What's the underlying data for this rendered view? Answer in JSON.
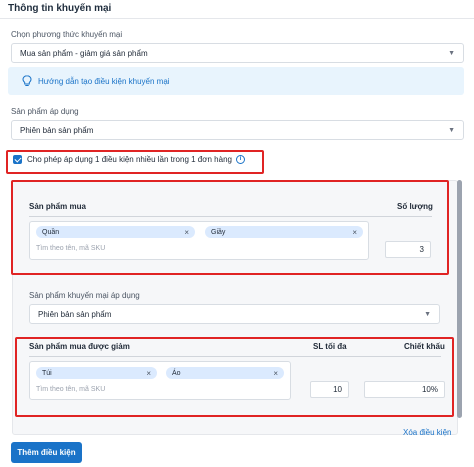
{
  "section": {
    "title": "Thông tin khuyến mại"
  },
  "promo_method": {
    "label": "Chọn phương thức khuyến mại",
    "value": "Mua sản phẩm - giảm giá sản phẩm"
  },
  "guide": {
    "link_text": "Hướng dẫn tạo điều kiện khuyến mại"
  },
  "applied_product": {
    "label": "Sản phẩm áp dụng",
    "value": "Phiên bản sản phẩm"
  },
  "allow_multiple": {
    "text": "Cho phép áp dụng 1 điều kiện nhiều lần trong 1 đơn hàng",
    "checked": true
  },
  "condition": {
    "buy": {
      "header_product": "Sản phẩm mua",
      "header_qty": "Số lượng",
      "tags": [
        "Quần",
        "Giầy"
      ],
      "search_hint": "Tìm theo tên, mã SKU",
      "quantity": "3"
    },
    "promo_applied": {
      "label": "Sản phẩm khuyến mại áp dụng",
      "value": "Phiên bản sản phẩm"
    },
    "discount": {
      "header_product": "Sản phẩm mua được giảm",
      "header_max_qty": "SL tối đa",
      "header_discount": "Chiết khấu",
      "tags": [
        "Túi",
        "Áo"
      ],
      "search_hint": "Tìm theo tên, mã SKU",
      "max_qty": "10",
      "discount": "10%"
    },
    "delete_link": "Xóa điều kiện"
  },
  "add_button": "Thêm điều kiện",
  "colors": {
    "accent": "#1a73c8",
    "highlight": "#e02424",
    "tag_bg": "#dbeafe",
    "guide_bg": "#e8f4fd"
  },
  "icons": {
    "remove_tag": "×",
    "dropdown": "chevron-down-icon",
    "bulb": "lightbulb-icon",
    "info": "info-icon"
  }
}
